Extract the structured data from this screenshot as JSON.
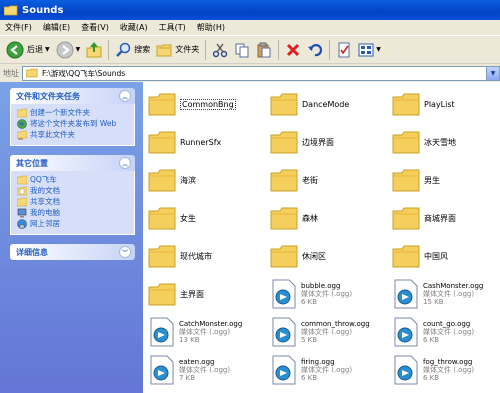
{
  "window": {
    "title": "Sounds"
  },
  "menu": [
    "文件(F)",
    "编辑(E)",
    "查看(V)",
    "收藏(A)",
    "工具(T)",
    "帮助(H)"
  ],
  "toolbar": {
    "back_label": "后退",
    "search_label": "搜索",
    "folders_label": "文件夹"
  },
  "address": {
    "label": "地址",
    "path": "F:\\游戏\\QQ飞车\\Sounds"
  },
  "sidebar": {
    "tasks": {
      "title": "文件和文件夹任务",
      "items": [
        "创建一个新文件夹",
        "将这个文件夹发布到 Web",
        "共享此文件夹"
      ]
    },
    "places": {
      "title": "其它位置",
      "items": [
        "QQ飞车",
        "我的文档",
        "共享文档",
        "我的电脑",
        "网上邻居"
      ]
    },
    "details": {
      "title": "详细信息"
    }
  },
  "folders": [
    "CommonBng",
    "DanceMode",
    "PlayList",
    "RunnerSfx",
    "边境界面",
    "冰天雪地",
    "海滨",
    "老街",
    "男生",
    "女生",
    "森林",
    "商城界面",
    "现代城市",
    "休闲区",
    "中国风",
    "主界面"
  ],
  "files": [
    {
      "name": "bubble.ogg",
      "type": "媒体文件 (.ogg)",
      "size": "6 KB"
    },
    {
      "name": "CashMonster.ogg",
      "type": "媒体文件 (.ogg)",
      "size": "15 KB"
    },
    {
      "name": "CatchMonster.ogg",
      "type": "媒体文件 (.ogg)",
      "size": "13 KB"
    },
    {
      "name": "common_throw.ogg",
      "type": "媒体文件 (.ogg)",
      "size": "5 KB"
    },
    {
      "name": "count_go.ogg",
      "type": "媒体文件 (.ogg)",
      "size": "6 KB"
    },
    {
      "name": "eaten.ogg",
      "type": "媒体文件 (.ogg)",
      "size": "7 KB"
    },
    {
      "name": "firing.ogg",
      "type": "媒体文件 (.ogg)",
      "size": "6 KB"
    },
    {
      "name": "fog_throw.ogg",
      "type": "媒体文件 (.ogg)",
      "size": "6 KB"
    }
  ]
}
